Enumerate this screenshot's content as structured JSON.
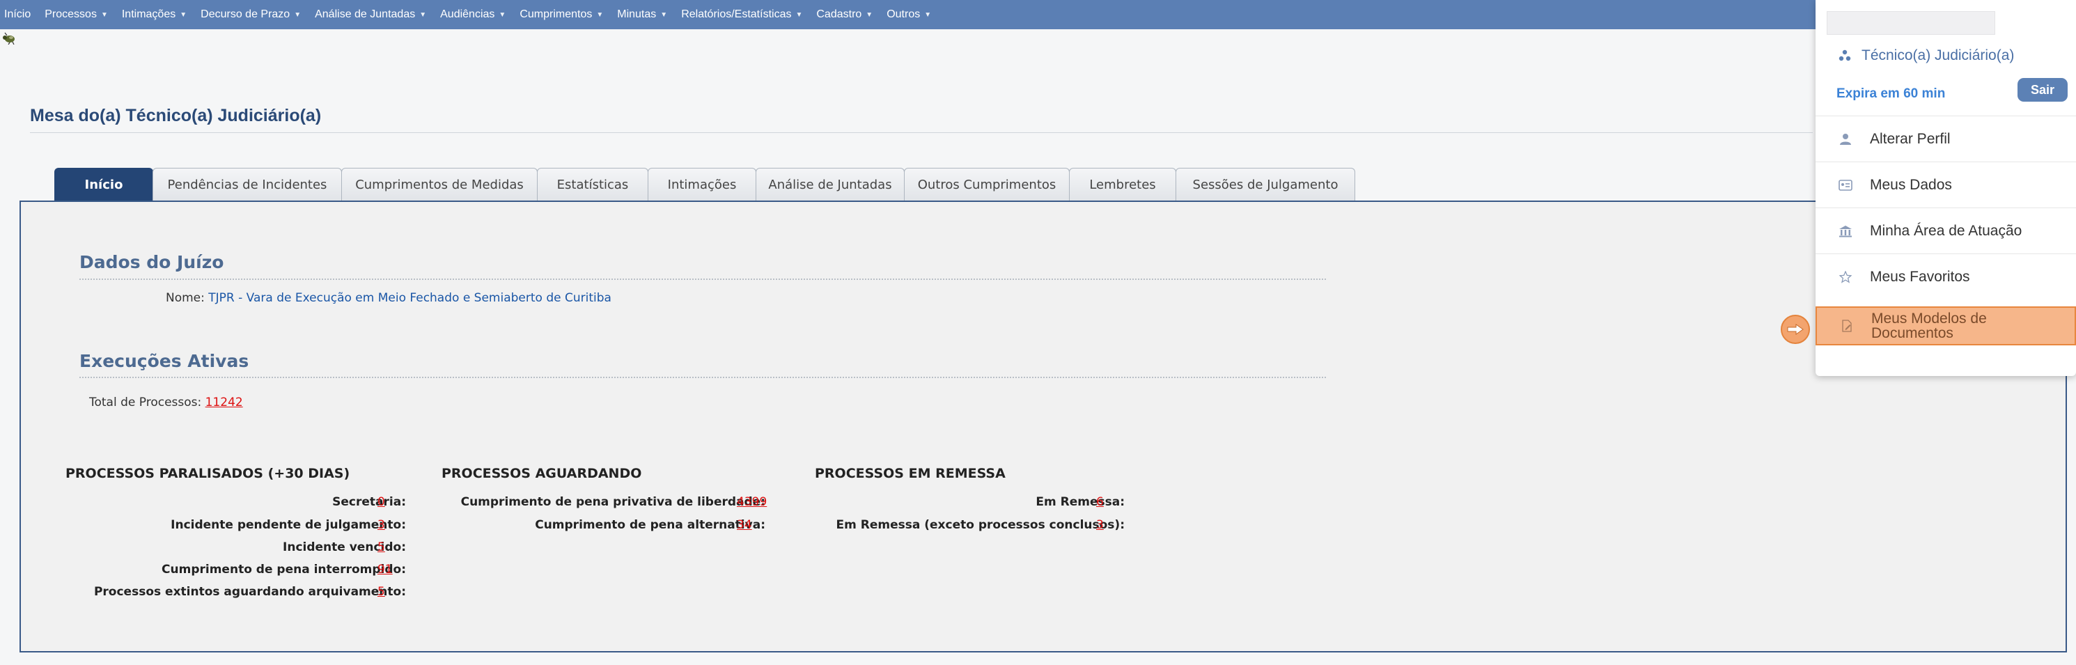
{
  "nav": {
    "items": [
      {
        "label": "Início",
        "caret": false
      },
      {
        "label": "Processos",
        "caret": true
      },
      {
        "label": "Intimações",
        "caret": true
      },
      {
        "label": "Decurso de Prazo",
        "caret": true
      },
      {
        "label": "Análise de Juntadas",
        "caret": true
      },
      {
        "label": "Audiências",
        "caret": true
      },
      {
        "label": "Cumprimentos",
        "caret": true
      },
      {
        "label": "Minutas",
        "caret": true
      },
      {
        "label": "Relatórios/Estatísticas",
        "caret": true
      },
      {
        "label": "Cadastro",
        "caret": true
      },
      {
        "label": "Outros",
        "caret": true
      }
    ]
  },
  "page": {
    "title": "Mesa do(a) Técnico(a) Judiciário(a)"
  },
  "tabs": [
    {
      "label": "Início",
      "active": true
    },
    {
      "label": "Pendências de Incidentes",
      "active": false
    },
    {
      "label": "Cumprimentos de Medidas",
      "active": false
    },
    {
      "label": "Estatísticas",
      "active": false
    },
    {
      "label": "Intimações",
      "active": false
    },
    {
      "label": "Análise de Juntadas",
      "active": false
    },
    {
      "label": "Outros Cumprimentos",
      "active": false
    },
    {
      "label": "Lembretes",
      "active": false
    },
    {
      "label": "Sessões de Julgamento",
      "active": false
    }
  ],
  "juizo": {
    "title": "Dados do Juízo",
    "nome_label": "Nome:",
    "nome_value": "TJPR - Vara de Execução em Meio Fechado e Semiaberto de Curitiba"
  },
  "execucoes": {
    "title": "Execuções Ativas",
    "total_label": "Total de Processos:",
    "total_value": "11242"
  },
  "paralisados": {
    "title": "PROCESSOS PARALISADOS (+30 DIAS)",
    "rows": [
      {
        "label": "Secretaria:",
        "value": "0"
      },
      {
        "label": "Incidente pendente de julgamento:",
        "value": "3"
      },
      {
        "label": "Incidente vencido:",
        "value": "5"
      },
      {
        "label": "Cumprimento de pena interrompido:",
        "value": "91"
      },
      {
        "label": "Processos extintos aguardando arquivamento:",
        "value": "5"
      }
    ]
  },
  "aguardando": {
    "title": "PROCESSOS AGUARDANDO",
    "rows": [
      {
        "label": "Cumprimento de pena privativa de liberdade:",
        "value": "4399"
      },
      {
        "label": "Cumprimento de pena alternativa:",
        "value": "34"
      }
    ]
  },
  "remessa": {
    "title": "PROCESSOS EM REMESSA",
    "rows": [
      {
        "label": "Em Remessa:",
        "value": "6"
      },
      {
        "label": "Em Remessa (exceto processos conclusos):",
        "value": "3"
      }
    ]
  },
  "user_menu": {
    "role": "Técnico(a) Judiciário(a)",
    "expira": "Expira em 60 min",
    "sair": "Sair",
    "items": [
      {
        "label": "Alterar Perfil",
        "icon": "user-icon"
      },
      {
        "label": "Meus Dados",
        "icon": "id-card-icon"
      },
      {
        "label": "Minha Área de Atuação",
        "icon": "building-icon"
      },
      {
        "label": "Meus Favoritos",
        "icon": "star-icon"
      },
      {
        "label": "Meus Modelos de Documentos",
        "icon": "document-edit-icon"
      }
    ]
  },
  "colors": {
    "nav_bg": "#5b7fb4",
    "title": "#2b4a77",
    "active_tab": "#244575",
    "highlight": "#f6b68a",
    "link_red": "#dd1111"
  }
}
